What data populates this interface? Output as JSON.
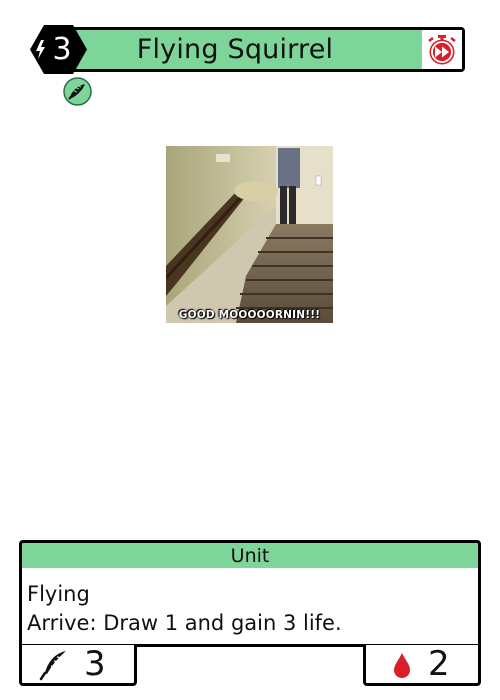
{
  "card": {
    "name": "Flying Squirrel",
    "cost": "3",
    "type": "Unit",
    "abilities": [
      "Flying",
      "Arrive: Draw 1 and gain 3 life."
    ],
    "attack": "3",
    "health": "2",
    "art_caption": "GOOD MOOOOORNIN!!!"
  },
  "icons": {
    "cost": "lightning-bolt-icon",
    "speed": "fast-forward-timer-icon",
    "tag": "feather-wing-icon",
    "attack": "feather-quill-icon",
    "health": "blood-drop-icon"
  },
  "colors": {
    "faction_green": "#7dd59a",
    "cost_black": "#000000",
    "speed_red": "#d8202a",
    "health_red": "#d8202a",
    "border": "#000000"
  }
}
